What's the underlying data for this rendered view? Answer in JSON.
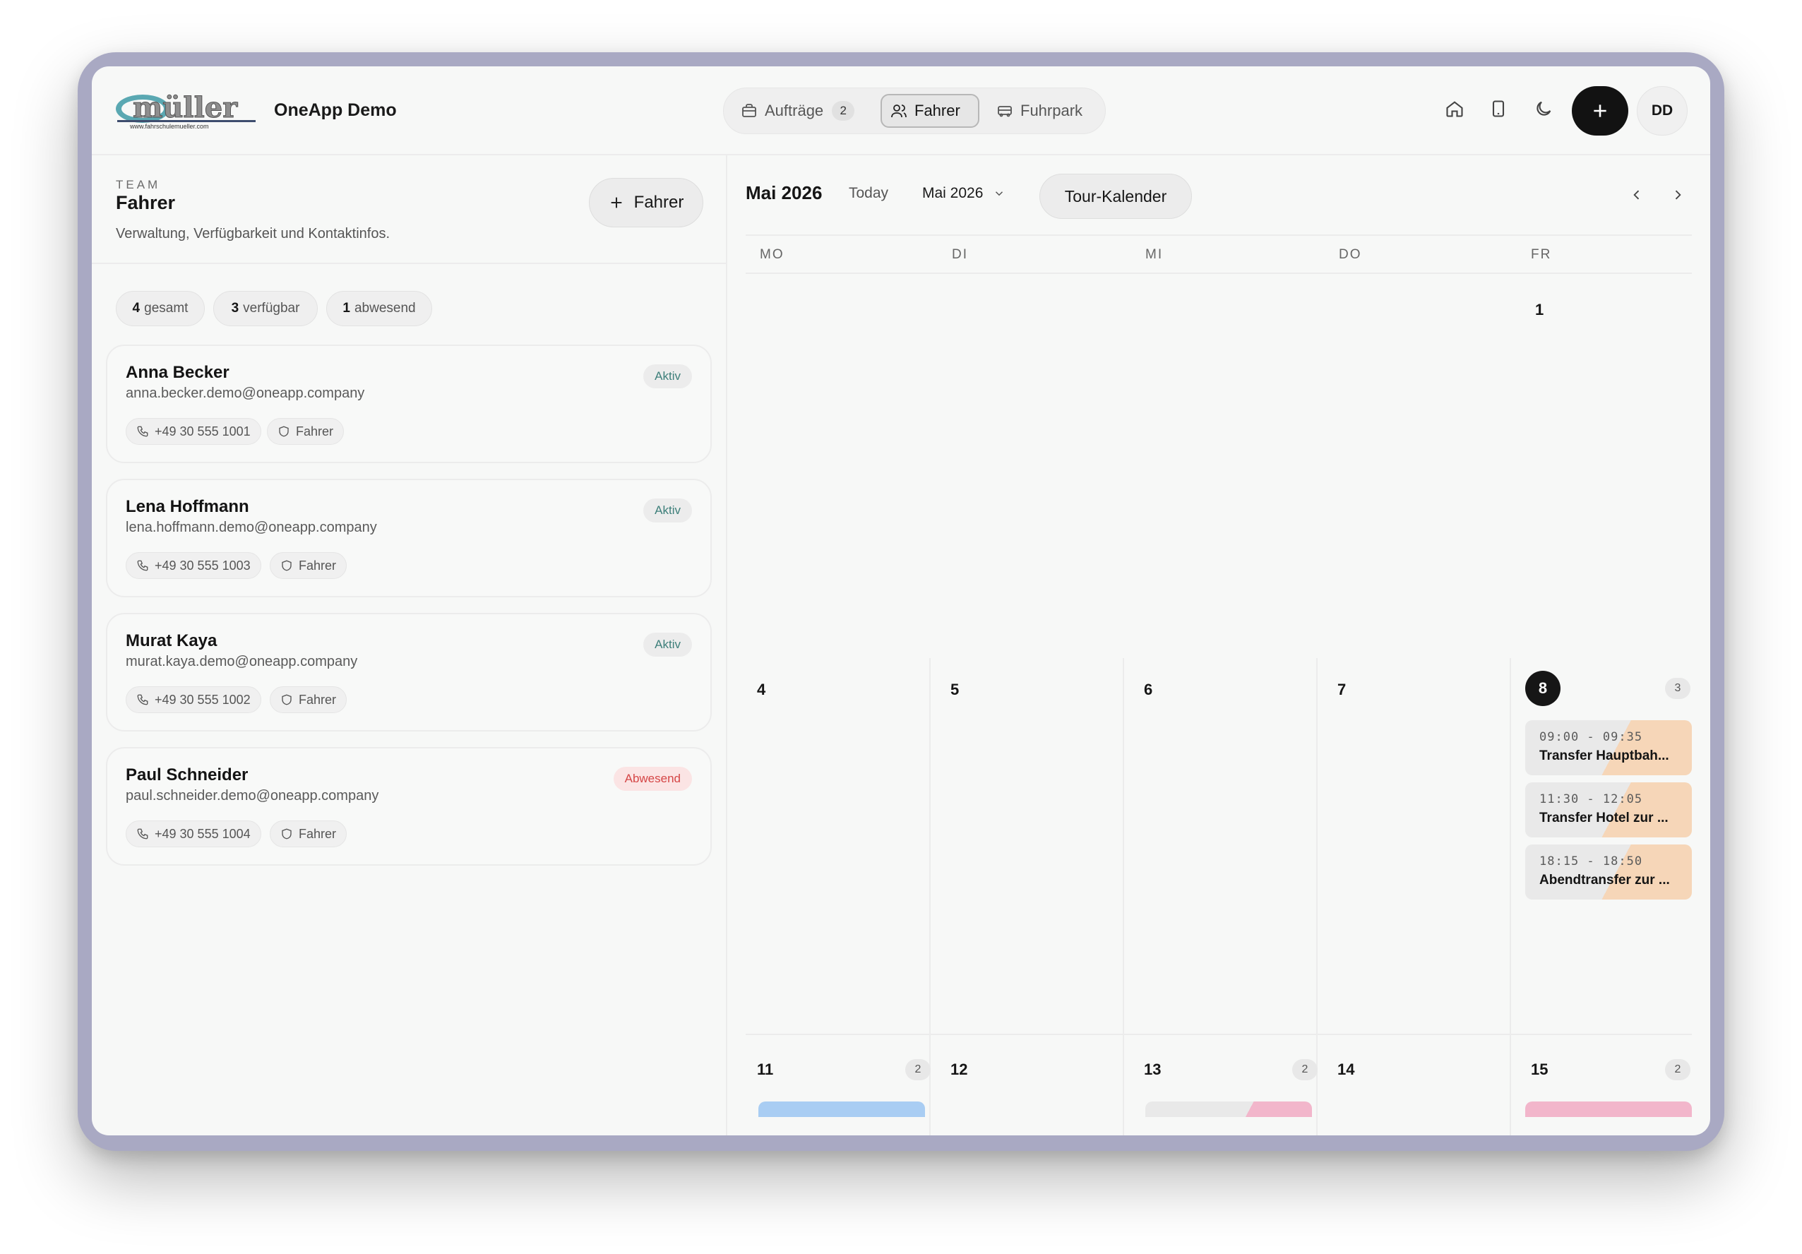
{
  "app": {
    "name": "OneApp Demo",
    "logo_text": "müller",
    "logo_subtext": "www.fahrschulemueller.com"
  },
  "nav": {
    "tabs": [
      {
        "label": "Aufträge",
        "badge": "2",
        "icon": "briefcase-icon"
      },
      {
        "label": "Fahrer",
        "icon": "users-icon",
        "active": true
      },
      {
        "label": "Fuhrpark",
        "icon": "bus-icon"
      }
    ]
  },
  "header": {
    "avatar_initials": "DD",
    "icons": [
      "home-icon",
      "tablet-icon",
      "moon-icon",
      "plus-icon"
    ]
  },
  "team": {
    "eyebrow": "TEAM",
    "title": "Fahrer",
    "description": "Verwaltung, Verfügbarkeit und Kontaktinfos.",
    "add_button": "Fahrer",
    "stats": [
      {
        "value": "4",
        "label": "gesamt"
      },
      {
        "value": "3",
        "label": "verfügbar"
      },
      {
        "value": "1",
        "label": "abwesend"
      }
    ]
  },
  "drivers": [
    {
      "name": "Anna Becker",
      "email": "anna.becker.demo@oneapp.company",
      "phone": "+49 30 555 1001",
      "role": "Fahrer",
      "status": "Aktiv"
    },
    {
      "name": "Lena Hoffmann",
      "email": "lena.hoffmann.demo@oneapp.company",
      "phone": "+49 30 555 1003",
      "role": "Fahrer",
      "status": "Aktiv"
    },
    {
      "name": "Murat Kaya",
      "email": "murat.kaya.demo@oneapp.company",
      "phone": "+49 30 555 1002",
      "role": "Fahrer",
      "status": "Aktiv"
    },
    {
      "name": "Paul Schneider",
      "email": "paul.schneider.demo@oneapp.company",
      "phone": "+49 30 555 1004",
      "role": "Fahrer",
      "status": "Abwesend"
    }
  ],
  "calendar": {
    "title": "Mai 2026",
    "today_label": "Today",
    "month_select": "Mai 2026",
    "tour_button": "Tour-Kalender",
    "weekdays": [
      "MO",
      "DI",
      "MI",
      "DO",
      "FR"
    ],
    "week1": {
      "fr": "1"
    },
    "week2": {
      "mo": "4",
      "di": "5",
      "mi": "6",
      "do": "7",
      "fr": "8",
      "fr_count": "3"
    },
    "week3": {
      "mo": "11",
      "mo_count": "2",
      "di": "12",
      "mi": "13",
      "mi_count": "2",
      "do": "14",
      "fr": "15",
      "fr_count": "2"
    },
    "events": [
      {
        "time": "09:00 - 09:35",
        "title": "Transfer Hauptbah..."
      },
      {
        "time": "11:30 - 12:05",
        "title": "Transfer Hotel zur ..."
      },
      {
        "time": "18:15 - 18:50",
        "title": "Abendtransfer zur ..."
      }
    ],
    "colors": {
      "event_accent": "#f6d6b8",
      "peek_blue": "#a9cdf3",
      "peek_pink": "#f2b6cb"
    }
  }
}
